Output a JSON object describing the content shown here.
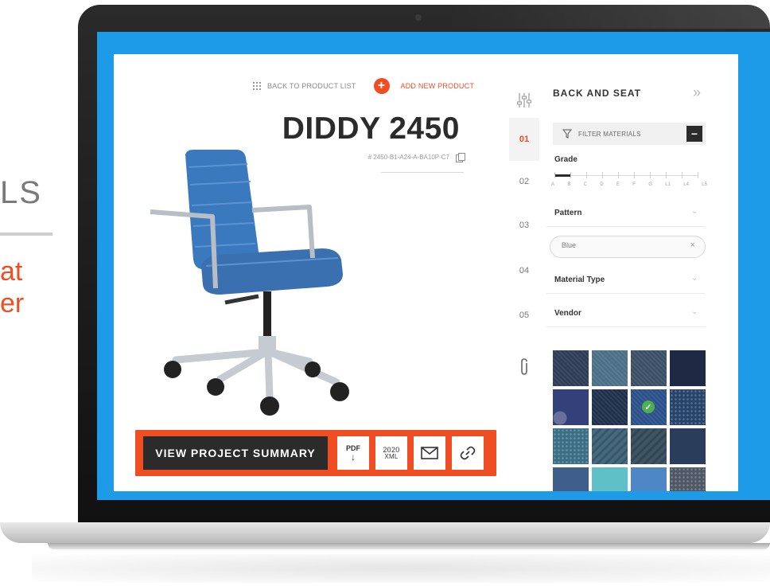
{
  "slide": {
    "fragment_1": "LS",
    "fragment_2": "at",
    "fragment_3": "er"
  },
  "nav": {
    "back_label": "BACK TO PRODUCT LIST",
    "add_label": "ADD NEW PRODUCT",
    "add_icon": "plus-icon",
    "back_icon": "grid-icon"
  },
  "product": {
    "title": "DIDDY 2450",
    "sku": "# 2450-B1-A24-A-BA10P-C7",
    "image": "blue-office-chair"
  },
  "actions": {
    "summary_label": "VIEW PROJECT SUMMARY",
    "pdf_label": "PDF",
    "pdf_arrow": "↓",
    "xml_top": "2020",
    "xml_bottom": "XML",
    "mail_icon": "envelope-icon",
    "link_icon": "link-icon"
  },
  "steps": {
    "items": [
      "01",
      "02",
      "03",
      "04",
      "05"
    ],
    "active": "01"
  },
  "panel": {
    "title": "BACK AND SEAT",
    "collapse_icon": "double-chevron-right",
    "filter_label": "FILTER MATERIALS",
    "filter_toggle": "−",
    "grade_label": "Grade",
    "grade_letters": [
      "A",
      "B",
      "C",
      "D",
      "E",
      "F",
      "G",
      "L1",
      "L4",
      "L5"
    ],
    "pattern_label": "Pattern",
    "chip_label": "Blue",
    "chip_remove": "×",
    "material_type_label": "Material Type",
    "vendor_label": "Vendor",
    "chevron": "⌄"
  },
  "colors": {
    "accent": "#ef4e23",
    "dark": "#2b2b2b",
    "screen_blue": "#1e9be8",
    "chair_blue": "#3b79bf"
  },
  "swatches": [
    {
      "color": "#2c3c55",
      "pattern": "stitch"
    },
    {
      "color": "#4a6f86",
      "pattern": "texture"
    },
    {
      "color": "#3a4e66",
      "pattern": "texture"
    },
    {
      "color": "#1e2a44",
      "pattern": "plain"
    },
    {
      "color": "#34407a",
      "pattern": "swirl"
    },
    {
      "color": "#1d2f4a",
      "pattern": "texture"
    },
    {
      "color": "#2a4f8a",
      "pattern": "texture",
      "selected": true
    },
    {
      "color": "#27446a",
      "pattern": "dots"
    },
    {
      "color": "#3b6f86",
      "pattern": "dots"
    },
    {
      "color": "#456a80",
      "pattern": "stripe"
    },
    {
      "color": "#3e5566",
      "pattern": "arrows"
    },
    {
      "color": "#2a3e5c",
      "pattern": "plain"
    },
    {
      "color": "#3f5f8a",
      "pattern": "plain"
    },
    {
      "color": "#60c0c8",
      "pattern": "plain"
    },
    {
      "color": "#4f86c6",
      "pattern": "plain"
    },
    {
      "color": "#505866",
      "pattern": "dots"
    }
  ]
}
